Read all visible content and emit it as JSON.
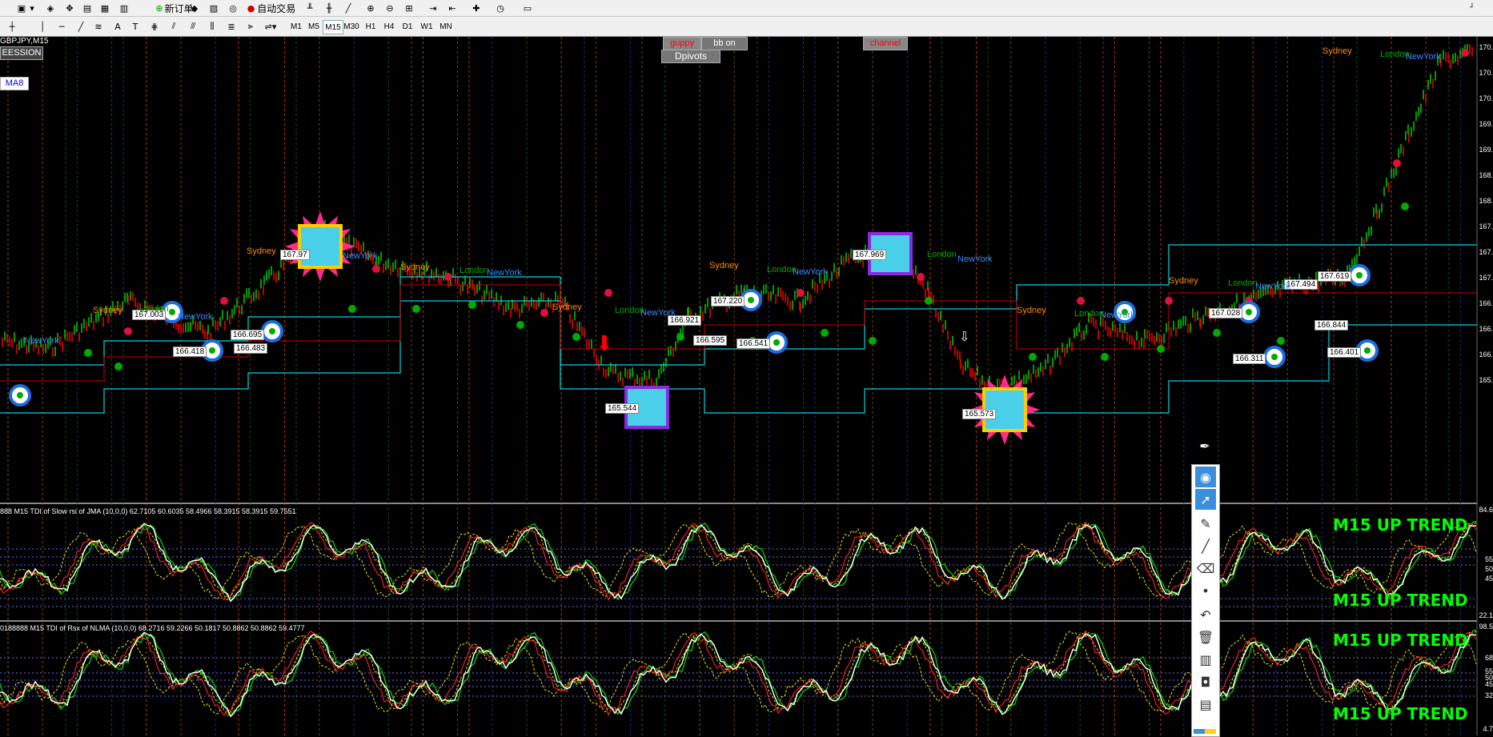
{
  "toolbar": {
    "new_order": "新订单",
    "auto_trading": "自动交易"
  },
  "timeframes": [
    "M1",
    "M5",
    "M15",
    "M30",
    "H1",
    "H4",
    "D1",
    "W1",
    "MN"
  ],
  "active_timeframe": "M15",
  "chart": {
    "symbol_label": "GBPJPY,M15",
    "session_button": "EESSION",
    "ma_button": "MA8",
    "buttons": {
      "guppy": "guppy",
      "bb_on": "bb on",
      "dpivots": "Dpivots",
      "channel": "channel"
    },
    "price_labels": [
      "167.003",
      "166.695",
      "166.418",
      "166.483",
      "167.97",
      "165.544",
      "166.921",
      "167.220",
      "166.595",
      "166.541",
      "167.969",
      "165.573",
      "167.028",
      "166.311",
      "167.494",
      "167.619",
      "166.844",
      "166.401"
    ],
    "session_labels": [
      "Sydney",
      "London",
      "NewYork"
    ],
    "y_axis": [
      "170.",
      "170.",
      "170.",
      "169.",
      "169.",
      "168.",
      "168.",
      "167.",
      "167.",
      "167.",
      "166.",
      "166.",
      "166.",
      "165."
    ]
  },
  "indicators": [
    {
      "header": "888 M15 TDI of Slow rsi of JMA (10,0,0) 62.7105 60.6035 58.4966 58.3915 58.3915 59.7551",
      "trend_top": "M15 UP TREND",
      "trend_bottom": "M15 UP TREND",
      "y_axis": [
        "84.6",
        "55",
        "50",
        "45",
        "22.1"
      ]
    },
    {
      "header": "0188888 M15 TDI of Rsx of NLMA (10,0,0) 68.2716 59.2266 50.1817 50.8862 50.8862 59.4777",
      "trend_top": "M15 UP TREND",
      "trend_bottom": "M15 UP TREND",
      "y_axis": [
        "98.5",
        "68",
        "55",
        "50",
        "45",
        "32",
        "4.7"
      ]
    }
  ],
  "colors": {
    "bull": "#00cc00",
    "bear": "#ff0000",
    "cyan": "#00d5e0",
    "trend": "#00ff00",
    "pivot_red": "#e0103a"
  }
}
